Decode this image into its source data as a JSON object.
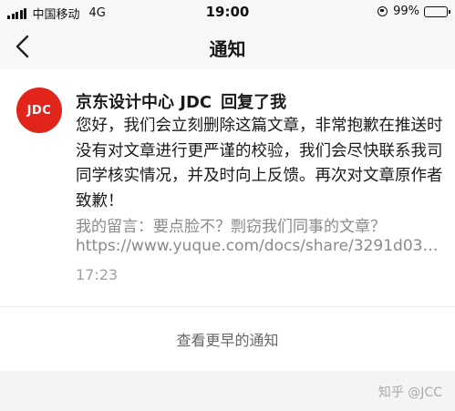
{
  "status_bar": {
    "carrier": "中国移动",
    "network": "4G",
    "time": "19:00",
    "battery": "99%",
    "battery_level": 0.99
  },
  "nav": {
    "title": "通知",
    "back_icon": "chevron-left-icon"
  },
  "notification": {
    "avatar_text": "JDC",
    "avatar_color": "#e1251b",
    "sender": "京东设计中心 JDC",
    "action": "回复了我",
    "reply_text": "您好，我们会立刻删除这篇文章，非常抱歉在推送时没有对文章进行更严谨的校验，我们会尽快联系我司同学核实情况，并及时向上反馈。再次对文章原作者致歉！",
    "quote_label": "我的留言：要点脸不？剽窃我们同事的文章？",
    "quote_url": "https://www.yuque.com/docs/share/3291d035...",
    "time": "17:23"
  },
  "more_link": "查看更早的通知",
  "watermark": "知乎 @JCC"
}
